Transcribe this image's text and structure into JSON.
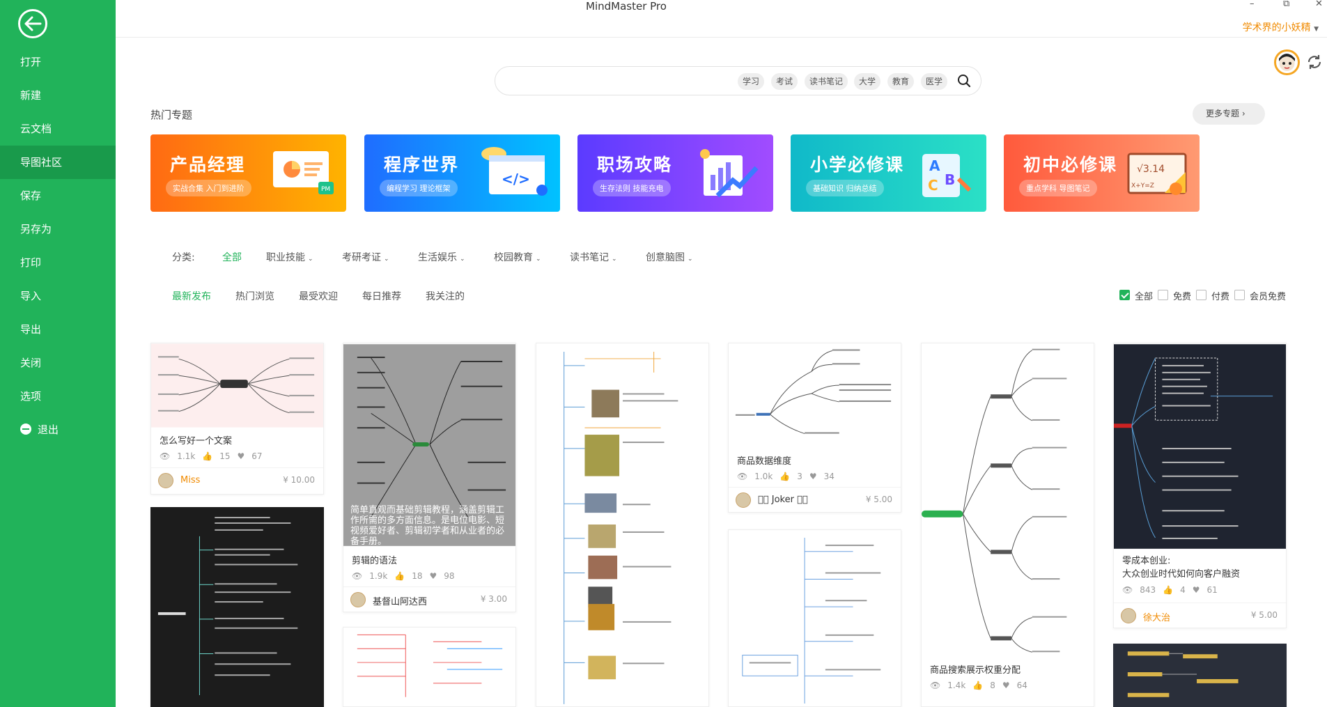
{
  "app": {
    "title": "MindMaster Pro",
    "user_name": "学术界的小妖精"
  },
  "sidebar": {
    "items": [
      {
        "label": "打开"
      },
      {
        "label": "新建"
      },
      {
        "label": "云文档"
      },
      {
        "label": "导图社区"
      },
      {
        "label": "保存"
      },
      {
        "label": "另存为"
      },
      {
        "label": "打印"
      },
      {
        "label": "导入"
      },
      {
        "label": "导出"
      },
      {
        "label": "关闭"
      },
      {
        "label": "选项"
      },
      {
        "label": "退出"
      }
    ],
    "active_index": 3
  },
  "search": {
    "placeholder": "",
    "tags": [
      "学习",
      "考试",
      "读书笔记",
      "大学",
      "教育",
      "医学"
    ]
  },
  "topics": {
    "title": "热门专题",
    "more_label": "更多专题",
    "banners": [
      {
        "title": "产品经理",
        "subtitle": "实战合集 入门到进阶",
        "color_from": "#ff6a13",
        "color_to": "#ffb300"
      },
      {
        "title": "程序世界",
        "subtitle": "编程学习 理论框架",
        "color_from": "#1f6dff",
        "color_to": "#00c2ff"
      },
      {
        "title": "职场攻略",
        "subtitle": "生存法则 技能充电",
        "color_from": "#5b3bff",
        "color_to": "#a14cff"
      },
      {
        "title": "小学必修课",
        "subtitle": "基础知识 归纳总结",
        "color_from": "#10b9c9",
        "color_to": "#2be0c6"
      },
      {
        "title": "初中必修课",
        "subtitle": "重点学科 导图笔记",
        "color_from": "#ff5a3c",
        "color_to": "#ff9a72"
      }
    ]
  },
  "categories": {
    "label": "分类:",
    "items": [
      "全部",
      "职业技能",
      "考研考证",
      "生活娱乐",
      "校园教育",
      "读书笔记",
      "创意脑图"
    ],
    "active_index": 0
  },
  "sort_tabs": {
    "items": [
      "最新发布",
      "热门浏览",
      "最受欢迎",
      "每日推荐",
      "我关注的"
    ],
    "active_index": 0
  },
  "filters": [
    {
      "label": "全部",
      "checked": true
    },
    {
      "label": "免费",
      "checked": false
    },
    {
      "label": "付费",
      "checked": false
    },
    {
      "label": "会员免费",
      "checked": false
    }
  ],
  "cards": [
    {
      "title": "怎么写好一个文案",
      "views": "1.1k",
      "likes": "15",
      "favs": "67",
      "author": "Miss",
      "price": "¥ 10.00"
    },
    {
      "title": "剪辑的语法",
      "overlay": "简单直观而基础剪辑教程，涵盖剪辑工作所需的多方面信息。是电位电影、短视频爱好者、剪辑初学者和从业者的必备手册。",
      "views": "1.9k",
      "likes": "18",
      "favs": "98",
      "author": "基督山阿达西",
      "price": "¥ 3.00"
    },
    {
      "title": "商品数据维度",
      "views": "1.0k",
      "likes": "3",
      "favs": "34",
      "author": "ঌ⃝ Joker ঌ⃝",
      "price": "¥ 5.00"
    },
    {
      "title": "商品搜索展示权重分配",
      "views": "1.4k",
      "likes": "8",
      "favs": "64"
    },
    {
      "title": "零成本创业:\n大众创业时代如何向客户融资",
      "views": "843",
      "likes": "4",
      "favs": "61",
      "author": "徐大治",
      "price": "¥ 5.00"
    }
  ]
}
